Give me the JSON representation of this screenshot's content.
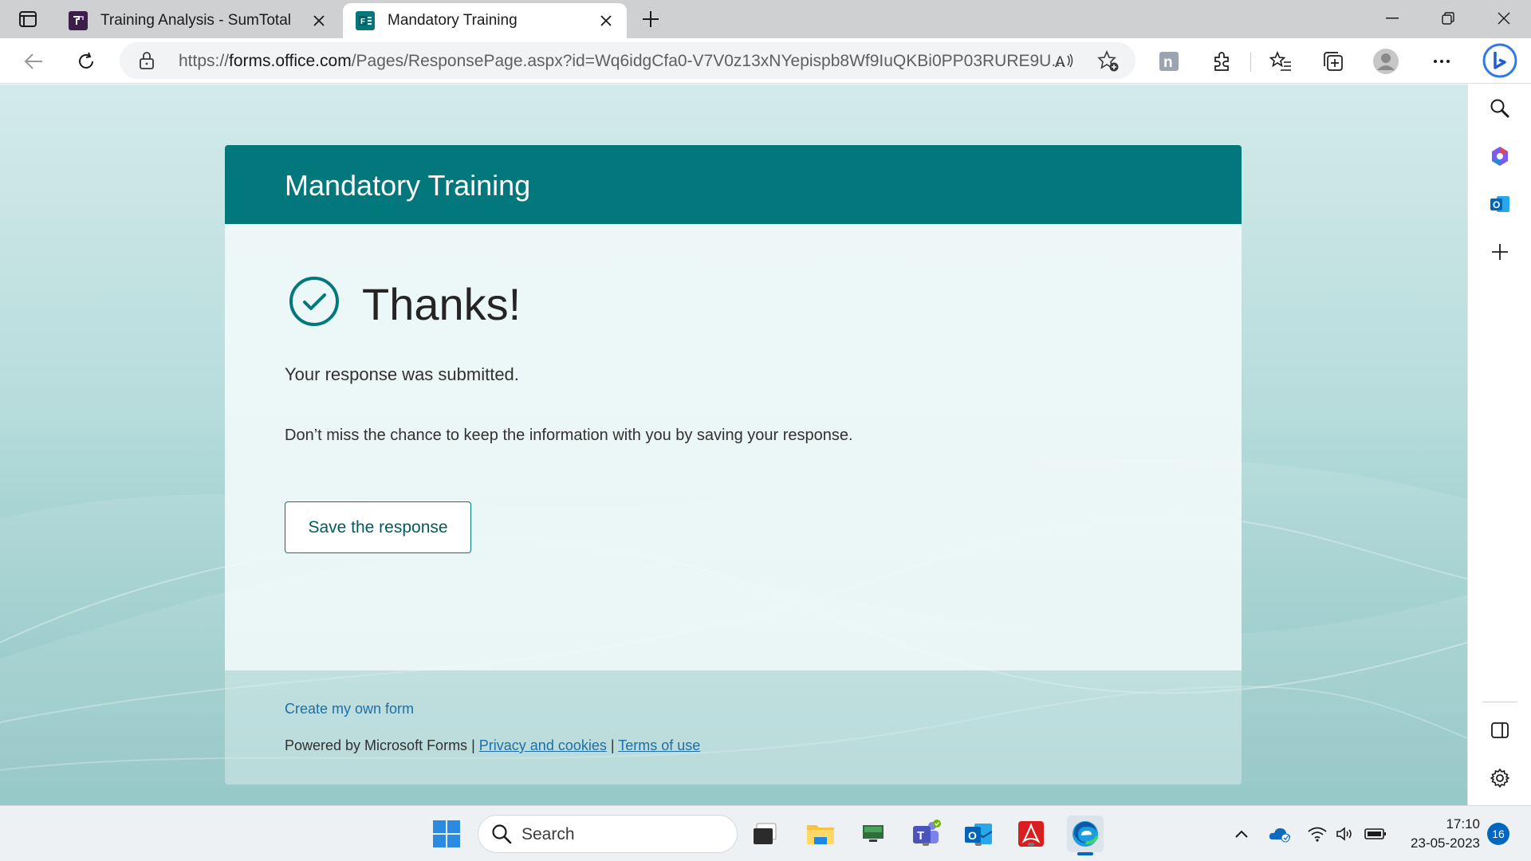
{
  "browser": {
    "tabs": [
      {
        "label": "Training Analysis - SumTotal",
        "favicon_color": "#3b1f4a",
        "active": false
      },
      {
        "label": "Mandatory Training",
        "favicon_color": "#03787c",
        "active": true
      }
    ],
    "address_bar": {
      "scheme": "https://",
      "host": "forms.office.com",
      "path": "/Pages/ResponsePage.aspx?id=Wq6idgCfa0-V7V0z13xNYepispb8Wf9IuQKBi0PP03RURE9U..."
    }
  },
  "form": {
    "title": "Mandatory Training",
    "thanks_heading": "Thanks!",
    "submitted_message": "Your response was submitted.",
    "save_prompt": "Don’t miss the chance to keep the information with you by saving your response.",
    "save_button_label": "Save the response",
    "footer": {
      "create_form_link": "Create my own form",
      "powered_by": "Powered by Microsoft Forms",
      "separator": "|",
      "privacy_link": "Privacy and cookies",
      "terms_link": "Terms of use"
    }
  },
  "taskbar": {
    "search_label": "Search",
    "time": "17:10",
    "date": "23-05-2023",
    "notification_count": "16"
  },
  "colors": {
    "accent": "#03787c",
    "link": "#1d6fa8",
    "edge_blue": "#0067c0"
  }
}
